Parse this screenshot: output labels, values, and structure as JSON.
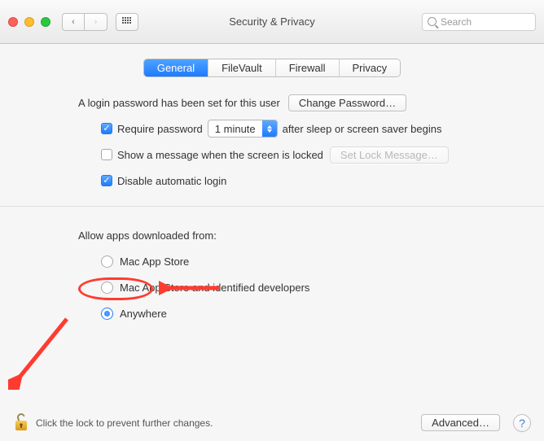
{
  "window": {
    "title": "Security & Privacy"
  },
  "search": {
    "placeholder": "Search"
  },
  "tabs": [
    "General",
    "FileVault",
    "Firewall",
    "Privacy"
  ],
  "active_tab": 0,
  "login": {
    "header": "A login password has been set for this user",
    "change_button": "Change Password…",
    "require_label_pre": "Require password",
    "require_select": "1 minute",
    "require_label_post": "after sleep or screen saver begins",
    "require_checked": true,
    "show_msg_label": "Show a message when the screen is locked",
    "show_msg_checked": false,
    "set_lock_button": "Set Lock Message…",
    "disable_auto_label": "Disable automatic login",
    "disable_auto_checked": true
  },
  "gatekeeper": {
    "header": "Allow apps downloaded from:",
    "options": [
      "Mac App Store",
      "Mac App Store and identified developers",
      "Anywhere"
    ],
    "selected": 2
  },
  "footer": {
    "lock_text": "Click the lock to prevent further changes.",
    "advanced_button": "Advanced…",
    "help_glyph": "?"
  },
  "annotations": [
    {
      "type": "oval",
      "target": "anywhere"
    },
    {
      "type": "arrow",
      "target": "anywhere"
    },
    {
      "type": "arrow",
      "target": "lock"
    }
  ]
}
